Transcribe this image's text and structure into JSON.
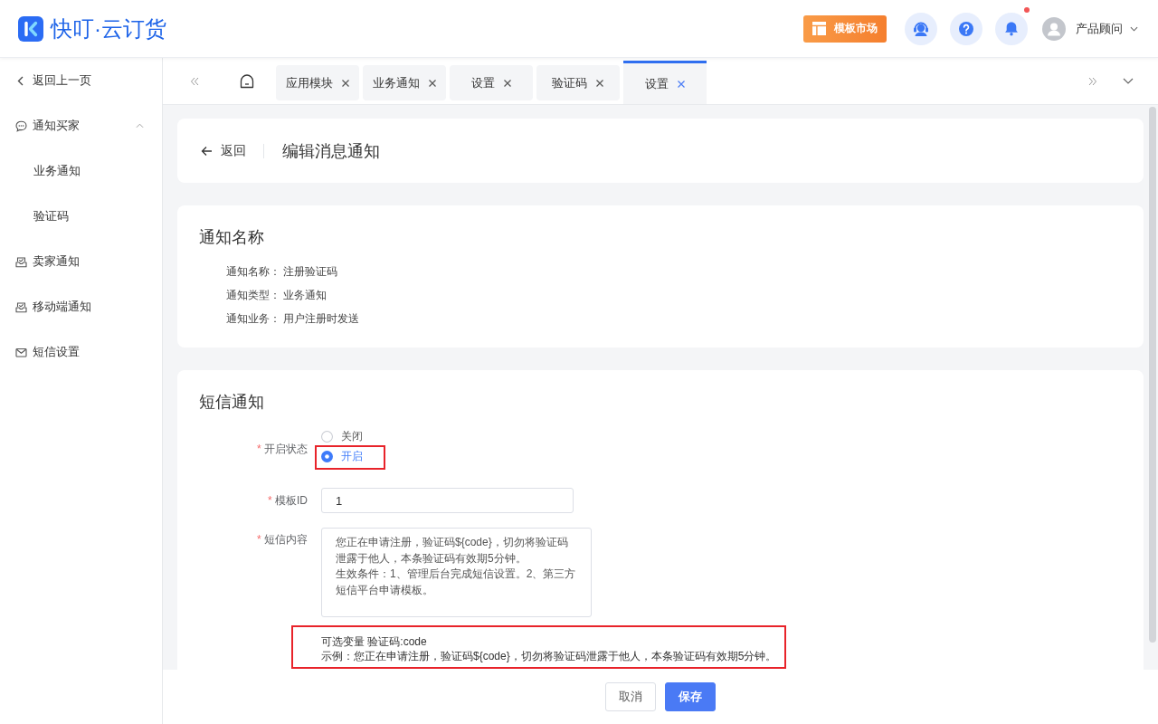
{
  "header": {
    "logo_text": "快叮·云订货",
    "market_button": "模板市场",
    "has_unread": true,
    "user_name": "产品顾问"
  },
  "sidebar": {
    "back_label": "返回上一页",
    "items": [
      {
        "label": "通知买家",
        "expanded": true,
        "selected": false,
        "children": [
          {
            "label": "业务通知",
            "selected": false
          },
          {
            "label": "验证码",
            "selected": false
          }
        ]
      },
      {
        "label": "卖家通知",
        "selected": false
      },
      {
        "label": "移动端通知",
        "selected": false
      },
      {
        "label": "短信设置",
        "selected": false
      }
    ]
  },
  "tabs": [
    {
      "label": "应用模块",
      "selected": false
    },
    {
      "label": "业务通知",
      "selected": false
    },
    {
      "label": "设置",
      "selected": false
    },
    {
      "label": "验证码",
      "selected": false
    },
    {
      "label": "设置",
      "selected": true
    }
  ],
  "page_header": {
    "back_label": "返回",
    "title": "编辑消息通知"
  },
  "info_card": {
    "title": "通知名称",
    "rows": [
      {
        "label": "通知名称：",
        "value": "注册验证码"
      },
      {
        "label": "通知类型：",
        "value": "业务通知"
      },
      {
        "label": "通知业务：",
        "value": "用户注册时发送"
      }
    ]
  },
  "sms_card": {
    "title": "短信通知",
    "status_field": {
      "required_mark": "*",
      "label": "开启状态",
      "options": [
        {
          "label": "关闭",
          "selected": false,
          "highlighted": false
        },
        {
          "label": "开启",
          "selected": true,
          "highlighted": true
        }
      ]
    },
    "template_field": {
      "required_mark": "*",
      "label": "模板ID",
      "value": "1"
    },
    "content_field": {
      "required_mark": "*",
      "label": "短信内容",
      "paragraphs": [
        "您正在申请注册，验证码${code}，切勿将验证码泄露于他人，本条验证码有效期5分钟。",
        "生效条件：1、管理后台完成短信设置。2、第三方短信平台申请模板。"
      ]
    },
    "hint": {
      "highlighted": true,
      "lines": [
        "可选变量 验证码:code",
        "示例：您正在申请注册，验证码${code}，切勿将验证码泄露于他人，本条验证码有效期5分钟。"
      ]
    }
  },
  "footer": {
    "buttons": [
      {
        "label": "取消",
        "kind": "secondary"
      },
      {
        "label": "保存",
        "kind": "primary"
      }
    ]
  }
}
